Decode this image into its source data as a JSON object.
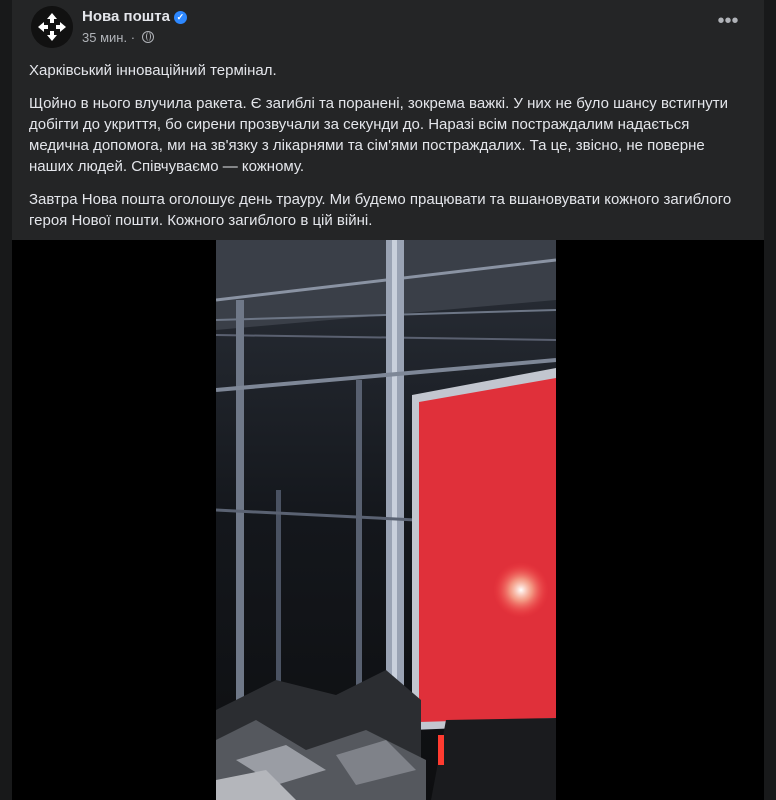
{
  "post": {
    "author": "Нова пошта",
    "time": "35 мин.",
    "paragraphs": [
      "Харківський інноваційний термінал.",
      "Щойно в нього влучила ракета. Є загиблі та поранені, зокрема важкі. У них не було шансу встигнути добігти до укриття, бо сирени прозвучали за секунди до. Наразі всім постраждалим надається медична допомога, ми на зв'язку з лікарнями та сім'ями постраждалих. Та це, звісно, не поверне наших людей. Співчуваємо — кожному.",
      "Завтра Нова пошта оголошує день трауру. Ми будемо працювати та вшановувати кожного загиблого героя Нової пошти. Кожного загиблого в цій війні."
    ]
  },
  "icons": {
    "avatar": "nova-poshta-logo",
    "verified": "verified-badge-icon",
    "audience": "globe-icon",
    "more": "more-options-icon"
  },
  "colors": {
    "background": "#18191a",
    "card": "#242526",
    "text": "#e4e6eb",
    "secondary_text": "#b0b3b8",
    "verified": "#2d88ff",
    "truck_red": "#e0303a"
  }
}
